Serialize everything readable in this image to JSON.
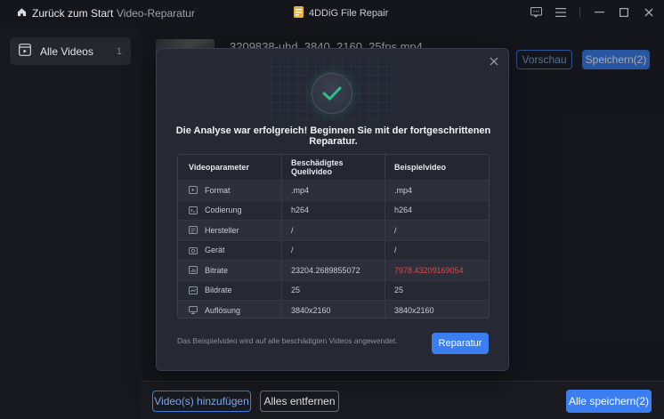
{
  "titlebar": {
    "back_label": "Zurück zum Start",
    "separator": "/",
    "breadcrumb": "Video-Reparatur",
    "app_name": "4DDiG File Repair"
  },
  "sidebar": {
    "items": [
      {
        "label": "Alle Videos",
        "count": "1"
      }
    ]
  },
  "file": {
    "name": "3209838-uhd_3840_2160_25fps.mp4",
    "preview_label": "Vorschau",
    "save_label": "Speichern(2)"
  },
  "footer": {
    "add_label": "Video(s) hinzufügen",
    "remove_label": "Alles entfernen",
    "save_all_label": "Alle speichern(2)"
  },
  "dialog": {
    "title": "Die Analyse war erfolgreich! Beginnen Sie mit der fortgeschrittenen Reparatur.",
    "columns": [
      "Videoparameter",
      "Beschädigtes Quellvideo",
      "Beispielvideo"
    ],
    "rows": [
      {
        "icon": "format-icon",
        "param": "Format",
        "source": ".mp4",
        "sample": ".mp4"
      },
      {
        "icon": "codec-icon",
        "param": "Codierung",
        "source": "h264",
        "sample": "h264"
      },
      {
        "icon": "manufacturer-icon",
        "param": "Hersteller",
        "source": "/",
        "sample": "/"
      },
      {
        "icon": "camera-icon",
        "param": "Gerät",
        "source": "/",
        "sample": "/"
      },
      {
        "icon": "bitrate-icon",
        "param": "Bitrate",
        "source": "23204.2689855072",
        "sample": "7978.43209169054"
      },
      {
        "icon": "framerate-icon",
        "param": "Bildrate",
        "source": "25",
        "sample": "25"
      },
      {
        "icon": "resolution-icon",
        "param": "Auflösung",
        "source": "3840x2160",
        "sample": "3840x2160"
      }
    ],
    "note": "Das Beispielvideo wird auf alle beschädigten Videos angewendet.",
    "repair_label": "Reparatur"
  },
  "colors": {
    "accent": "#3a7ef2",
    "mismatch": "#e2474b",
    "success": "#2ec28a"
  }
}
